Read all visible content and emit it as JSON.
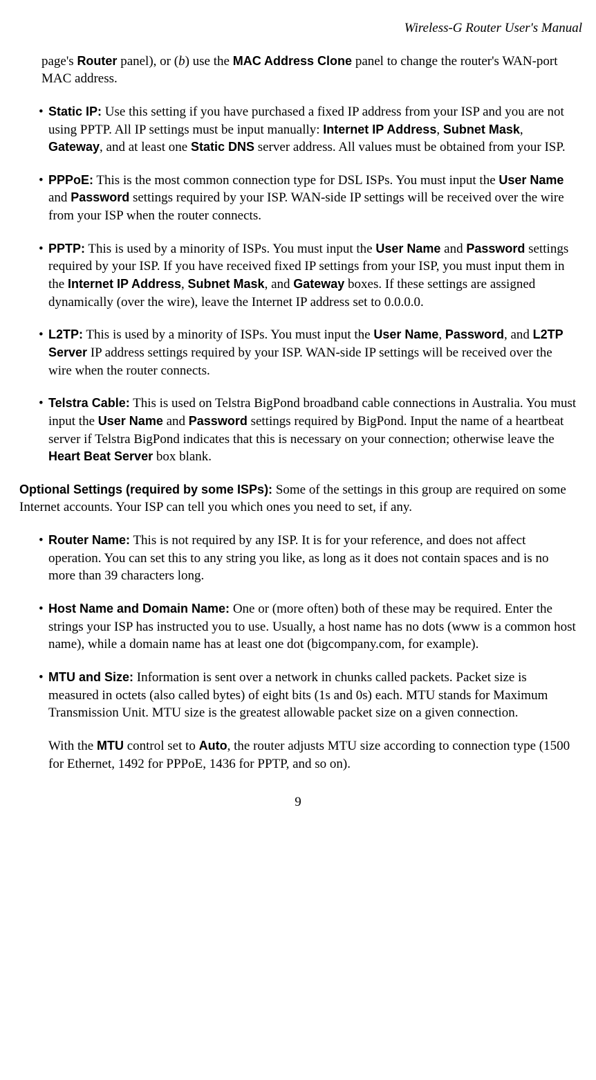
{
  "header": "Wireless-G Router User's Manual",
  "continued": {
    "t1": "page's ",
    "b1": "Router",
    "t2": " panel), or (",
    "i1": "b",
    "t3": ") use the ",
    "b2": "MAC Address Clone",
    "t4": " panel to change the router's WAN-port MAC address."
  },
  "staticip": {
    "label": "Static IP:",
    "t1": " Use this setting if you have purchased a fixed IP address from your ISP and you are not using PPTP. All IP settings must be input manually: ",
    "b1": "Internet IP Address",
    "c1": ", ",
    "b2": "Subnet Mask",
    "c2": ", ",
    "b3": "Gateway",
    "t2": ", and at least one ",
    "b4": "Static DNS",
    "t3": " server address. All values must be obtained from your ISP."
  },
  "pppoe": {
    "label": "PPPoE:",
    "t1": " This is the most common connection type for DSL ISPs. You must input the ",
    "b1": "User Name",
    "t2": " and ",
    "b2": "Password",
    "t3": " settings required by your ISP. WAN-side IP settings will be received over the wire from your ISP when the router connects."
  },
  "pptp": {
    "label": "PPTP:",
    "t1": " This is used by a minority of ISPs. You must input the ",
    "b1": "User Name",
    "t2": " and ",
    "b2": "Password",
    "t3": " settings required by your ISP. If you have received fixed IP settings from your ISP, you must input them in the ",
    "b3": "Internet IP Address",
    "c1": ", ",
    "b4": "Subnet Mask",
    "t4": ", and ",
    "b5": "Gateway",
    "t5": " boxes. If these settings are assigned dynamically (over the wire), leave the Internet IP address set to 0.0.0.0."
  },
  "l2tp": {
    "label": "L2TP:",
    "t1": " This is used by a minority of ISPs. You must input the ",
    "b1": "User Name",
    "c1": ", ",
    "b2": "Password",
    "t2": ", and ",
    "b3": "L2TP Server",
    "t3": " IP address settings required by your ISP. WAN-side IP settings will be received over the wire when the router connects."
  },
  "telstra": {
    "label": "Telstra Cable:",
    "t1": " This is used on Telstra BigPond broadband cable connections in Australia. You must input the ",
    "b1": "User Name",
    "t2": " and ",
    "b2": "Password",
    "t3": " settings required by BigPond. Input the name of a heartbeat server if Telstra BigPond indicates that this is necessary on your connection; otherwise leave the ",
    "b3": "Heart Beat Server",
    "t4": " box blank."
  },
  "optional": {
    "label": "Optional Settings (required by some ISPs):",
    "t1": " Some of the settings in this group are required on some Internet accounts. Your ISP can tell you which ones you need to set, if any."
  },
  "routername": {
    "label": "Router Name:",
    "t1": " This is not required by any ISP. It is for your reference, and does not affect operation. You can set this to any string you like, as long as it does not contain spaces and is no more than 39 characters long."
  },
  "hostdomain": {
    "label": "Host Name and Domain Name:",
    "t1": " One or (more often) both of these may be required. Enter the strings your ISP has instructed you to use. Usually, a host name has no dots (www is a common host name), while a domain name has at least one dot (bigcompany.com, for example)."
  },
  "mtu": {
    "label": "MTU and Size:",
    "t1": " Information is sent over a network in chunks called packets. Packet size is measured in octets (also called bytes) of eight bits (1s and 0s) each. MTU stands for Maximum Transmission Unit. MTU size is the greatest allowable packet size on a given connection.",
    "p2a": "With the ",
    "p2b1": "MTU",
    "p2b": " control set to ",
    "p2b2": "Auto",
    "p2c": ", the router adjusts MTU size according to connection type (1500 for Ethernet, 1492 for PPPoE, 1436 for PPTP, and so on)."
  },
  "page_number": "9",
  "bullet": "•"
}
